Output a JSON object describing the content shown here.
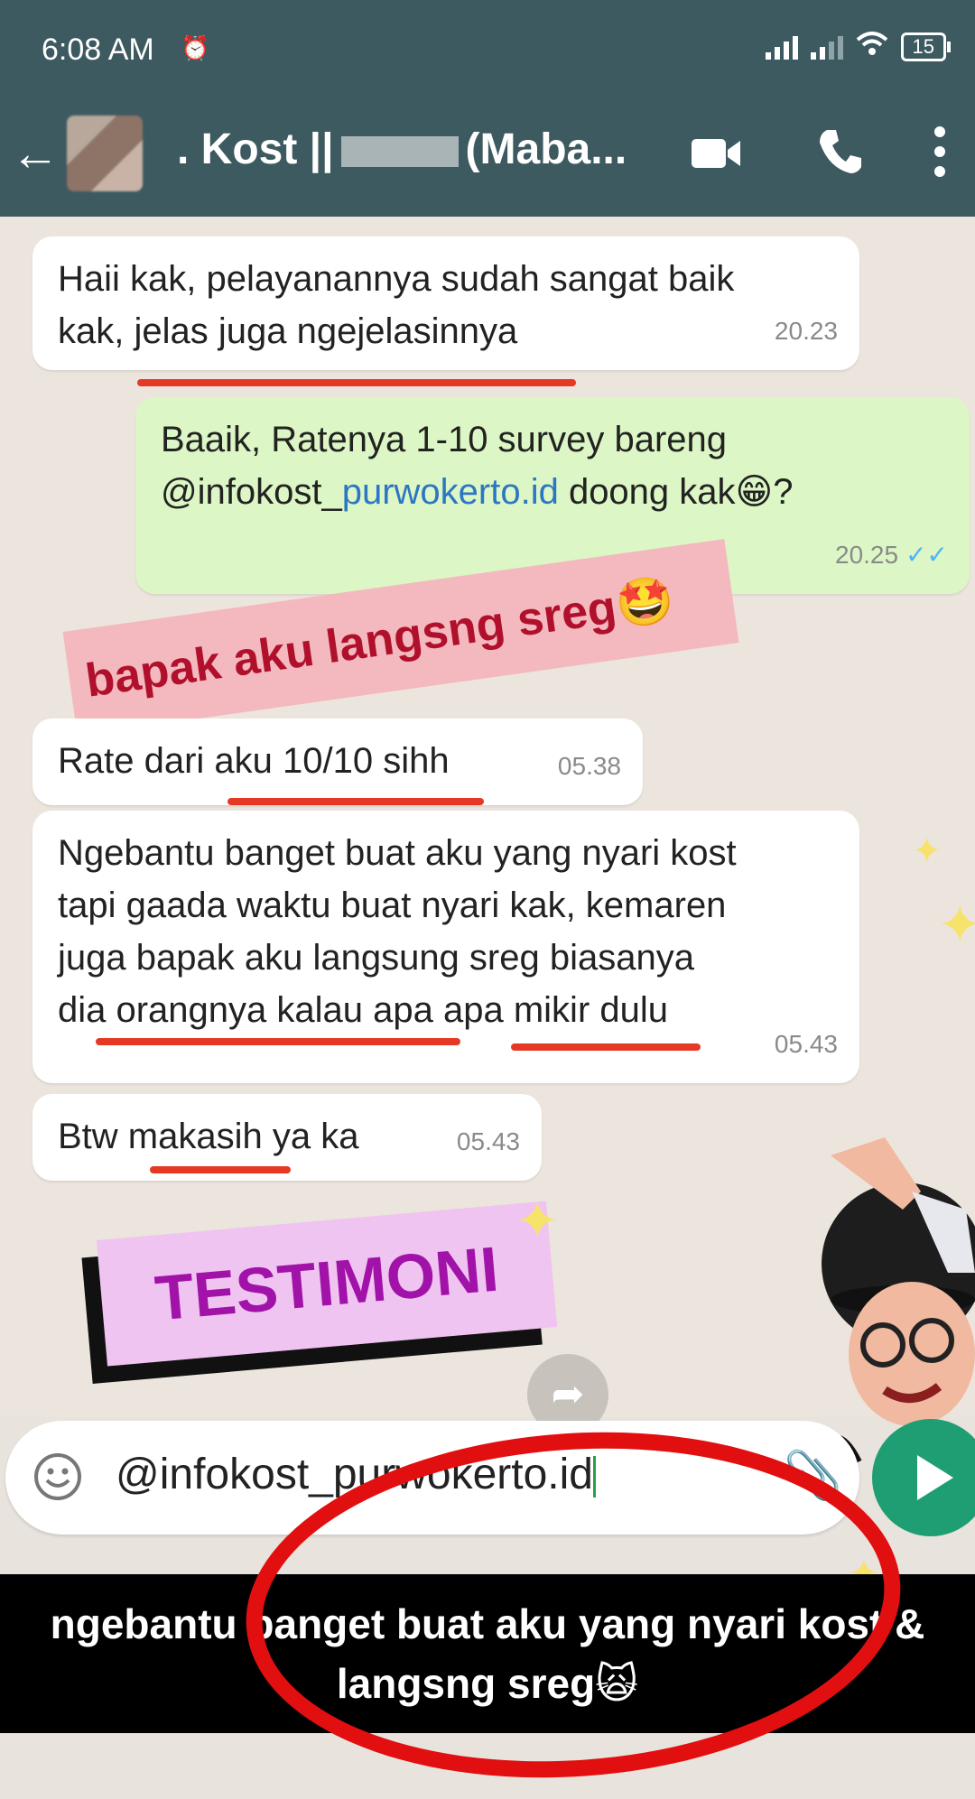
{
  "status": {
    "time": "6:08 AM",
    "alarm_icon": "alarm-icon",
    "battery": "15"
  },
  "header": {
    "back_icon": "back-arrow-icon",
    "title_prefix": ". Kost ||",
    "title_suffix": "(Maba...",
    "video_icon": "video-call-icon",
    "phone_icon": "phone-icon",
    "menu_icon": "more-vert-icon"
  },
  "messages": [
    {
      "text_1": "Haii kak, pelayanannya sudah sangat baik",
      "text_2": "kak, jelas juga ngejelasinnya",
      "time": "20.23"
    },
    {
      "text_1": "Baaik, Ratenya 1-10 survey bareng",
      "text_2_a": "@infokost_",
      "text_2_link": "purwokerto.id",
      "text_2_b": " doong kak😁?",
      "time": "20.25",
      "ticks": "✓✓"
    },
    {
      "text": "Rate dari aku 10/10 sihh",
      "time": "05.38"
    },
    {
      "text_1": "Ngebantu banget buat aku yang nyari kost",
      "text_2": "tapi gaada waktu buat nyari kak, kemaren",
      "text_3": "juga bapak aku langsung sreg biasanya",
      "text_4": "dia orangnya kalau apa apa mikir dulu",
      "time": "05.43"
    },
    {
      "text": "Btw makasih ya ka",
      "time": "05.43"
    }
  ],
  "overlay_caption": "bapak aku langsng sreg🤩",
  "testimoni": "TESTIMONI",
  "composer": {
    "text": "@infokost_purwokerto.id",
    "emoji_icon": "emoji-icon",
    "attach_icon": "attach-icon",
    "send_icon": "send-icon"
  },
  "subtitle_1": "ngebantu banget buat aku yang nyari kost &",
  "subtitle_2": "langsng sreg🙀",
  "colors": {
    "header": "#3d5a60",
    "outgoing": "#dcf7c5",
    "accent_red": "#e10f0f",
    "testimoni_purple": "#a012a8"
  }
}
